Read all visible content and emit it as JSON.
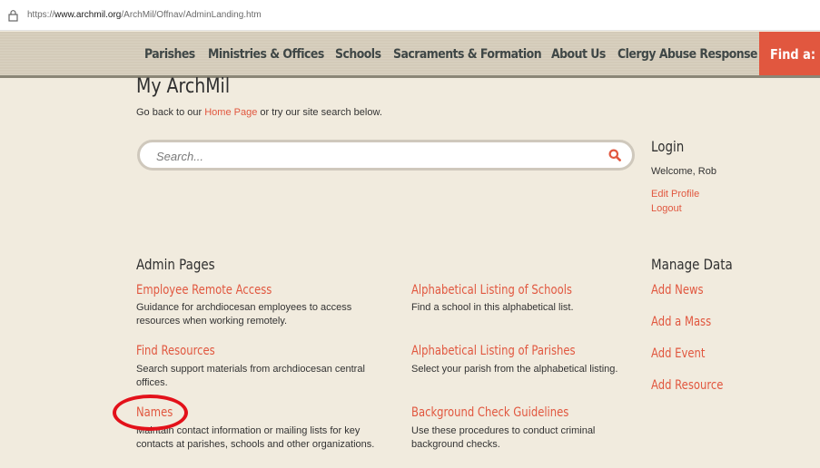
{
  "browser": {
    "url_prefix": "https://",
    "url_domain": "www.archmil.org",
    "url_path": "/ArchMil/Offnav/AdminLanding.htm"
  },
  "nav": {
    "items": [
      "Parishes",
      "Ministries & Offices",
      "Schools",
      "Sacraments & Formation",
      "About Us",
      "Clergy Abuse Response"
    ],
    "find_label": "Find a:"
  },
  "header": {
    "title": "My ArchMil",
    "sub_before": "Go back to our ",
    "sub_link": "Home Page",
    "sub_after": " or try our site search below."
  },
  "search": {
    "placeholder": "Search..."
  },
  "login": {
    "title": "Login",
    "welcome": "Welcome,  Rob",
    "edit_profile": "Edit Profile",
    "logout": "Logout"
  },
  "admin": {
    "title": "Admin Pages",
    "left": [
      {
        "title": "Employee Remote Access",
        "desc": "Guidance for archdiocesan employees to access resources when working remotely."
      },
      {
        "title": "Find Resources",
        "desc": "Search support materials from archdiocesan central offices."
      },
      {
        "title": "Names",
        "desc": "Maintain contact information or mailing lists for key contacts at parishes, schools and other organizations."
      }
    ],
    "right": [
      {
        "title": "Alphabetical Listing of Schools",
        "desc": "Find a school in this alphabetical list."
      },
      {
        "title": "Alphabetical Listing of Parishes",
        "desc": "Select your parish from the alphabetical listing."
      },
      {
        "title": "Background Check Guidelines",
        "desc": "Use these procedures to conduct criminal background checks."
      }
    ]
  },
  "manage": {
    "title": "Manage Data",
    "items": [
      "Add News",
      "Add a Mass",
      "Add Event",
      "Add Resource"
    ]
  },
  "colors": {
    "accent": "#e1573f",
    "background": "#f1ebde",
    "annotation": "#e3111a"
  }
}
